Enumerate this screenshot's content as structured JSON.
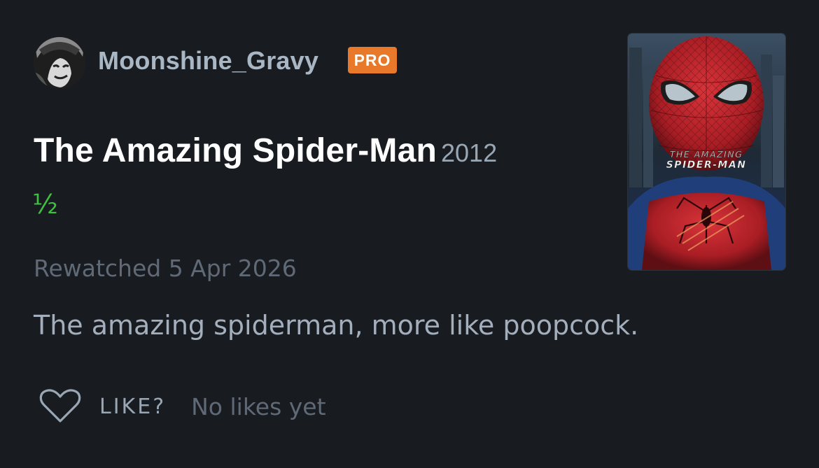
{
  "review": {
    "username": "Moonshine_Gravy",
    "badge": "PRO",
    "film_title": "The Amazing Spider-Man",
    "film_year": "2012",
    "rating": "½",
    "watched_date": "Rewatched 5 Apr 2026",
    "text": "The amazing spiderman, more like poopcock.",
    "like_label": "LIKE?",
    "likes_status": "No likes yet"
  },
  "poster": {
    "title_line1": "THE AMAZING",
    "title_line2": "SPIDER-MAN"
  },
  "colors": {
    "background": "#181b20",
    "badge": "#e8792a",
    "rating": "#40c040",
    "text_primary": "#ffffff",
    "text_secondary": "#99a6b4",
    "text_muted": "#606a76"
  }
}
